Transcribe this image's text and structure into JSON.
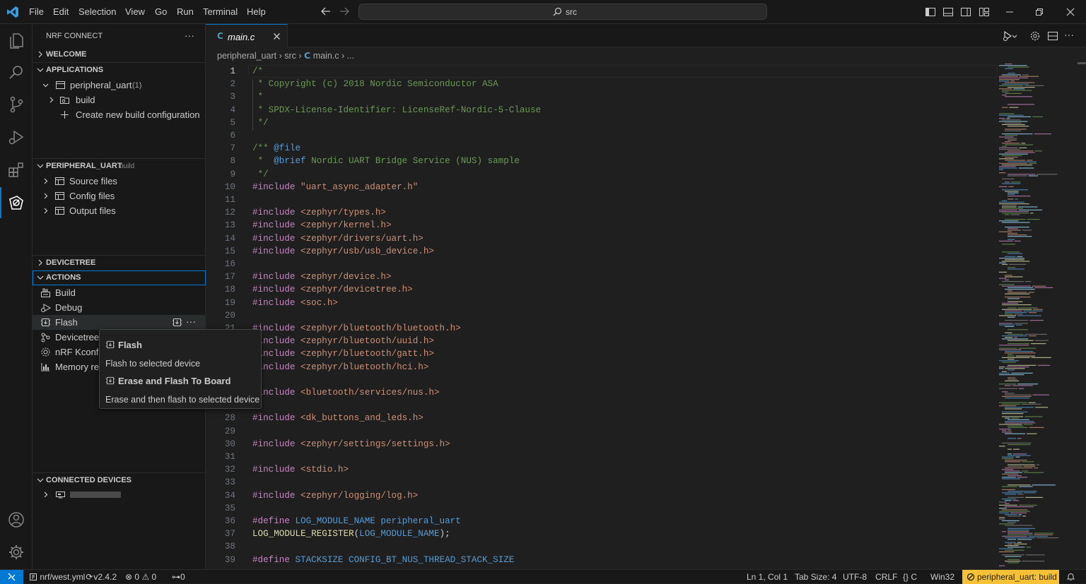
{
  "menu": [
    "File",
    "Edit",
    "Selection",
    "View",
    "Go",
    "Run",
    "Terminal",
    "Help"
  ],
  "search": {
    "text": "src"
  },
  "sidebar": {
    "title": "NRF CONNECT",
    "more": "···",
    "welcome": "WELCOME",
    "applications": "APPLICATIONS",
    "app_name": "peripheral_uart",
    "app_count": "(1)",
    "build_folder": "build",
    "create_build": "Create new build configuration",
    "project_section": "PERIPHERAL_UART",
    "project_sub": "build",
    "source_files": "Source files",
    "config_files": "Config files",
    "output_files": "Output files",
    "devicetree": "DEVICETREE",
    "actions": "ACTIONS",
    "action_build": "Build",
    "action_debug": "Debug",
    "action_flash": "Flash",
    "action_devicetree": "Devicetree",
    "action_kconfig": "nRF Kconfig",
    "action_memory": "Memory re",
    "connected_devices": "CONNECTED DEVICES"
  },
  "tooltip": {
    "flash_title": "Flash",
    "flash_desc": "Flash to selected device",
    "erase_title": "Erase and Flash To Board",
    "erase_desc": "Erase and then flash to selected device"
  },
  "editor": {
    "tab_label": "main.c",
    "tab_icon": "C",
    "breadcrumb": {
      "p1": "peripheral_uart",
      "p2": "src",
      "p3": "main.c",
      "p4": "..."
    }
  },
  "code": {
    "lines": [
      {
        "n": "1",
        "t": "/*"
      },
      {
        "n": "2",
        "t": " * Copyright (c) 2018 Nordic Semiconductor ASA"
      },
      {
        "n": "3",
        "t": " *"
      },
      {
        "n": "4",
        "t": " * SPDX-License-Identifier: LicenseRef-Nordic-5-Clause"
      },
      {
        "n": "5",
        "t": " */"
      },
      {
        "n": "6",
        "t": ""
      },
      {
        "n": "7",
        "a": "/** ",
        "b": "@file"
      },
      {
        "n": "8",
        "a": " *  ",
        "b": "@brief",
        "c": " Nordic UART Bridge Service (NUS) sample"
      },
      {
        "n": "9",
        "t": " */"
      },
      {
        "n": "10",
        "a": "#include ",
        "b": "\"uart_async_adapter.h\""
      },
      {
        "n": "11",
        "t": ""
      },
      {
        "n": "12",
        "a": "#include ",
        "b": "<zephyr/types.h>"
      },
      {
        "n": "13",
        "a": "#include ",
        "b": "<zephyr/kernel.h>"
      },
      {
        "n": "14",
        "a": "#include ",
        "b": "<zephyr/drivers/uart.h>"
      },
      {
        "n": "15",
        "a": "#include ",
        "b": "<zephyr/usb/usb_device.h>"
      },
      {
        "n": "16",
        "t": ""
      },
      {
        "n": "17",
        "a": "#include ",
        "b": "<zephyr/device.h>"
      },
      {
        "n": "18",
        "a": "#include ",
        "b": "<zephyr/devicetree.h>"
      },
      {
        "n": "19",
        "a": "#include ",
        "b": "<soc.h>"
      },
      {
        "n": "20",
        "t": ""
      },
      {
        "n": "21",
        "a": "#include ",
        "b": "<zephyr/bluetooth/bluetooth.h>"
      },
      {
        "n": "22",
        "a": "#include ",
        "b": "<zephyr/bluetooth/uuid.h>"
      },
      {
        "n": "23",
        "a": "#include ",
        "b": "<zephyr/bluetooth/gatt.h>"
      },
      {
        "n": "24",
        "a": "#include ",
        "b": "<zephyr/bluetooth/hci.h>"
      },
      {
        "n": "25",
        "t": ""
      },
      {
        "n": "26",
        "a": "#include ",
        "b": "<bluetooth/services/nus.h>"
      },
      {
        "n": "27",
        "t": ""
      },
      {
        "n": "28",
        "a": "#include ",
        "b": "<dk_buttons_and_leds.h>"
      },
      {
        "n": "29",
        "t": ""
      },
      {
        "n": "30",
        "a": "#include ",
        "b": "<zephyr/settings/settings.h>"
      },
      {
        "n": "31",
        "t": ""
      },
      {
        "n": "32",
        "a": "#include ",
        "b": "<stdio.h>"
      },
      {
        "n": "33",
        "t": ""
      },
      {
        "n": "34",
        "a": "#include ",
        "b": "<zephyr/logging/log.h>"
      },
      {
        "n": "35",
        "t": ""
      },
      {
        "n": "36",
        "a": "#define ",
        "m": "LOG_MODULE_NAME",
        "r": " peripheral_uart"
      },
      {
        "n": "37",
        "f": "LOG_MODULE_REGISTER",
        "p": "(",
        "m": "LOG_MODULE_NAME",
        "q": ");"
      },
      {
        "n": "38",
        "t": ""
      },
      {
        "n": "39",
        "a": "#define ",
        "m": "STACKSIZE",
        "r": " CONFIG_BT_NUS_THREAD_STACK_SIZE"
      }
    ]
  },
  "status": {
    "branch": "nrf/west.yml",
    "version": "v2.4.2",
    "errors": "0",
    "warnings": "0",
    "ports": "0",
    "position": "Ln 1, Col 1",
    "tab_size": "Tab Size: 4",
    "encoding": "UTF-8",
    "eol": "CRLF",
    "language": "C",
    "platform": "Win32",
    "build": "peripheral_uart: build"
  }
}
